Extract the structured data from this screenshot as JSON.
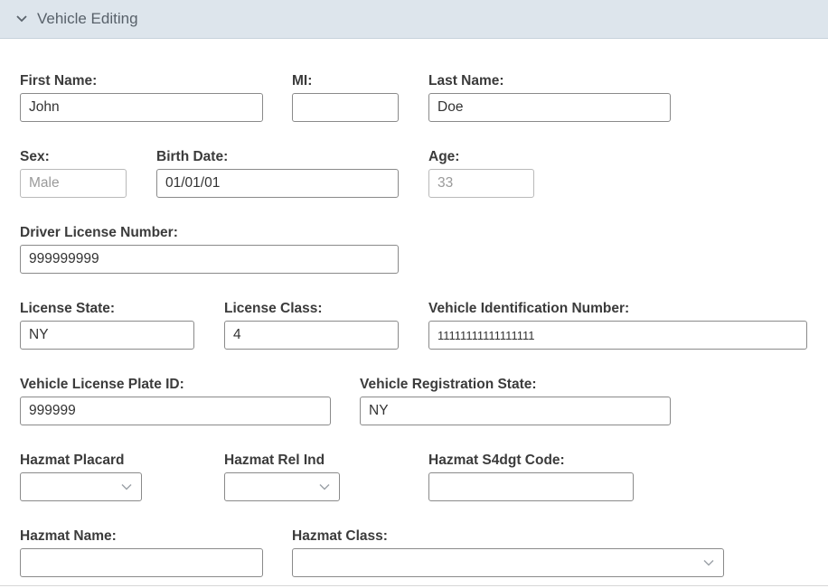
{
  "header": {
    "title": "Vehicle Editing",
    "icon": "chevron-down-icon"
  },
  "fields": {
    "first_name": {
      "label": "First Name:",
      "value": "John"
    },
    "mi": {
      "label": "MI:",
      "value": ""
    },
    "last_name": {
      "label": "Last Name:",
      "value": "Doe"
    },
    "sex": {
      "label": "Sex:",
      "value": "Male"
    },
    "birth_date": {
      "label": "Birth Date:",
      "value": "01/01/01"
    },
    "age": {
      "label": "Age:",
      "value": "33"
    },
    "driver_license": {
      "label": "Driver License Number:",
      "value": "999999999"
    },
    "license_state": {
      "label": "License State:",
      "value": "NY"
    },
    "license_class": {
      "label": "License Class:",
      "value": "4"
    },
    "vin": {
      "label": "Vehicle Identification Number:",
      "value": "11111111111111111"
    },
    "plate_id": {
      "label": "Vehicle License Plate ID:",
      "value": "999999"
    },
    "registration_state": {
      "label": "Vehicle Registration State:",
      "value": "NY"
    },
    "hazmat_placard": {
      "label": "Hazmat Placard",
      "value": ""
    },
    "hazmat_rel_ind": {
      "label": "Hazmat Rel Ind",
      "value": ""
    },
    "hazmat_s4dgt": {
      "label": "Hazmat S4dgt Code:",
      "value": ""
    },
    "hazmat_name": {
      "label": "Hazmat Name:",
      "value": ""
    },
    "hazmat_class": {
      "label": "Hazmat Class:",
      "value": ""
    }
  }
}
